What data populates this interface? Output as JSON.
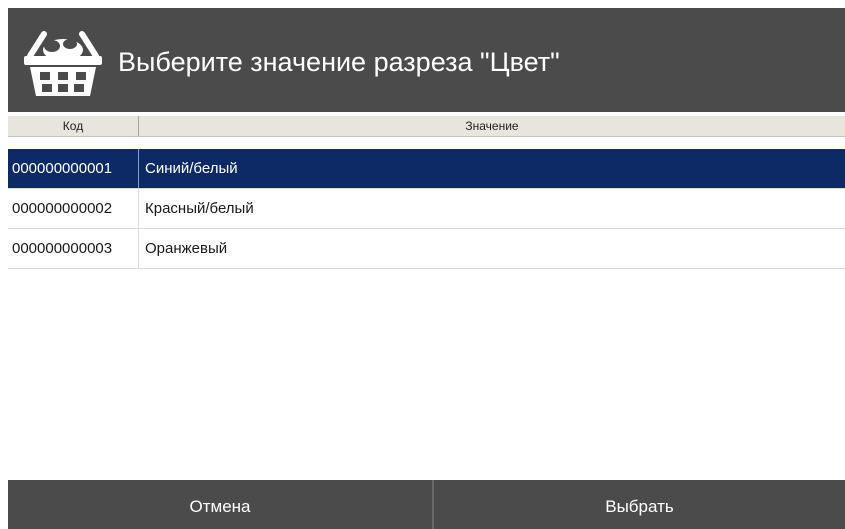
{
  "dialog": {
    "title": "Выберите значение разреза \"Цвет\"",
    "icon": "basket-icon"
  },
  "table": {
    "columns": [
      "Код",
      "Значение"
    ],
    "rows": [
      {
        "code": "000000000001",
        "value": "Синий/белый",
        "selected": true
      },
      {
        "code": "000000000002",
        "value": "Красный/белый",
        "selected": false
      },
      {
        "code": "000000000003",
        "value": "Оранжевый",
        "selected": false
      }
    ]
  },
  "buttons": {
    "cancel": "Отмена",
    "select": "Выбрать"
  },
  "colors": {
    "header_bg": "#4b4b4b",
    "selected_row_bg": "#0d2a66",
    "column_header_bg": "#e8e5df"
  }
}
